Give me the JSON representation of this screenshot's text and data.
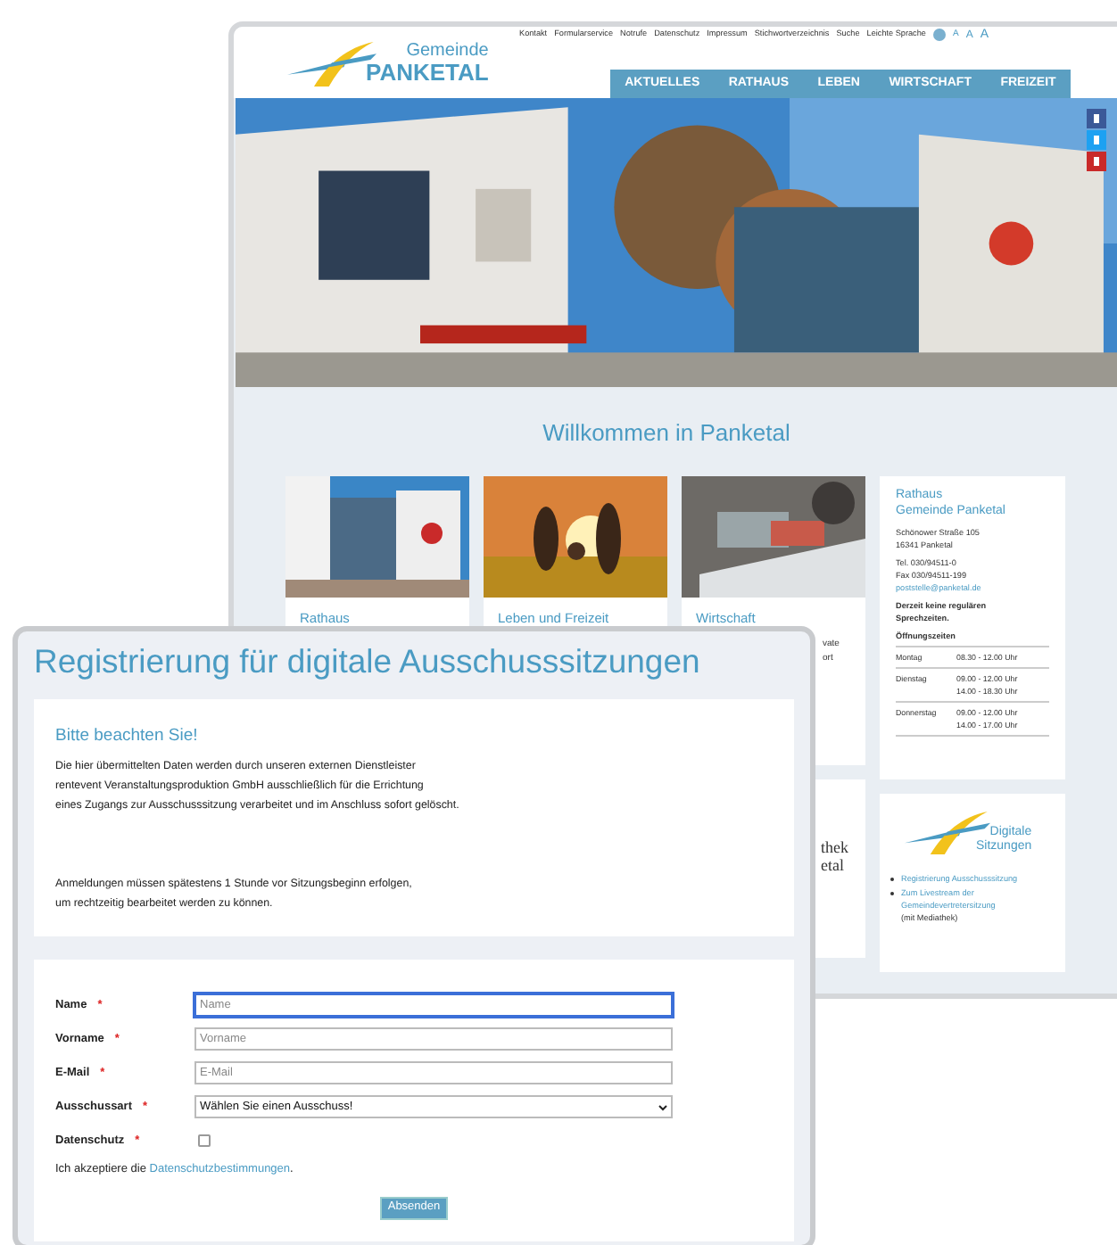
{
  "back_window": {
    "logo": {
      "line_1": "Gemeinde",
      "line_2": "PANKETAL"
    },
    "top_links": [
      "Kontakt",
      "Formularservice",
      "Notrufe",
      "Datenschutz",
      "Impressum",
      "Stichwortverzeichnis",
      "Suche",
      "Leichte Sprache"
    ],
    "font_size_buttons": [
      "A",
      "A",
      "A"
    ],
    "nav": [
      {
        "label": "AKTUELLES"
      },
      {
        "label": "RATHAUS"
      },
      {
        "label": "LEBEN"
      },
      {
        "label": "WIRTSCHAFT"
      },
      {
        "label": "FREIZEIT"
      }
    ],
    "welcome_title": "Willkommen in Panketal",
    "cards": [
      {
        "title": "Rathaus"
      },
      {
        "title": "Leben und Freizeit"
      },
      {
        "title": "Wirtschaft",
        "text_lines": [
          "vate",
          "ort"
        ]
      }
    ],
    "info_box": {
      "title_lines": [
        "Rathaus",
        "Gemeinde Panketal"
      ],
      "address_lines": [
        "Schönower Straße 105",
        "16341 Panketal"
      ],
      "phone_lines": [
        "Tel. 030/94511-0",
        "Fax 030/94511-199"
      ],
      "email": "poststelle@panketal.de",
      "notice_lines": [
        "Derzeit keine regulären",
        "Sprechzeiten."
      ],
      "hours_title": "Öffnungszeiten",
      "hours": [
        {
          "day": "Montag",
          "times": [
            "08.30 - 12.00 Uhr"
          ]
        },
        {
          "day": "Dienstag",
          "times": [
            "09.00 - 12.00 Uhr",
            "14.00 - 18.30 Uhr"
          ]
        },
        {
          "day": "Donnerstag",
          "times": [
            "09.00 - 12.00 Uhr",
            "14.00 - 17.00 Uhr"
          ]
        }
      ]
    },
    "bottom_cards": [
      {
        "kind": "fragment",
        "lines": [
          "thek",
          "etal"
        ]
      },
      {
        "kind": "digital",
        "logo": {
          "line_1": "Digitale",
          "line_2": "Sitzungen"
        },
        "links": [
          {
            "link": "Registrierung Ausschusssitzung"
          },
          {
            "link": "Zum Livestream der Gemeindevertretersitzung",
            "suffix": "(mit Mediathek)"
          }
        ]
      }
    ]
  },
  "front_window": {
    "title": "Registrierung für digitale Ausschusssitzungen",
    "notice": {
      "heading": "Bitte beachten Sie!",
      "paragraphs": [
        [
          "Die hier übermittelten Daten werden durch unseren externen Dienstleister",
          "rentevent Veranstaltungsproduktion GmbH ausschließlich für die Errichtung",
          "eines Zugangs zur Ausschusssitzung verarbeitet und im Anschluss sofort gelöscht."
        ],
        [
          "Anmeldungen müssen spätestens 1 Stunde vor Sitzungsbeginn erfolgen,",
          "um rechtzeitig bearbeitet werden zu können."
        ]
      ]
    },
    "form": {
      "fields": [
        {
          "kind": "text",
          "label": "Name",
          "required_mark": "*",
          "placeholder": "Name",
          "focused": true
        },
        {
          "kind": "text",
          "label": "Vorname",
          "required_mark": "*",
          "placeholder": "Vorname",
          "focused": false
        },
        {
          "kind": "text",
          "label": "E-Mail",
          "required_mark": "*",
          "placeholder": "E-Mail",
          "focused": false
        },
        {
          "kind": "select",
          "label": "Ausschussart",
          "required_mark": "*",
          "value": "Wählen Sie einen Ausschuss!"
        },
        {
          "kind": "checkbox",
          "label": "Datenschutz",
          "required_mark": "*",
          "checked": false
        }
      ],
      "consent": {
        "text": "Ich akzeptiere die ",
        "link": "Datenschutzbestimmungen",
        "suffix": "."
      },
      "submit": "Absenden"
    }
  }
}
